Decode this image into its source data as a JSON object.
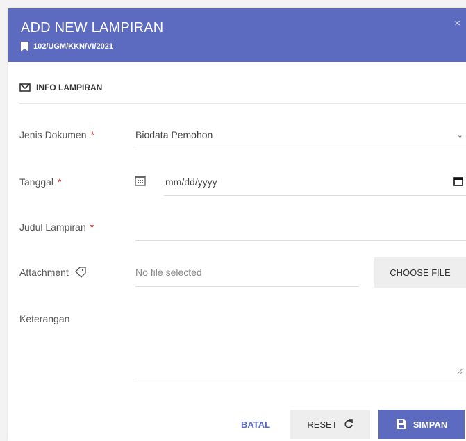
{
  "modal": {
    "title": "ADD NEW LAMPIRAN",
    "subtitle": "102/UGM/KKN/VI/2021",
    "close": "×"
  },
  "section": {
    "title": "INFO LAMPIRAN",
    "icon": "mail-icon"
  },
  "form": {
    "jenis_dokumen": {
      "label": "Jenis Dokumen",
      "required": "*",
      "value": "Biodata Pemohon",
      "chevron": "⌄"
    },
    "tanggal": {
      "label": "Tanggal",
      "required": "*",
      "placeholder": "mm/dd/yyyy"
    },
    "judul": {
      "label": "Judul Lampiran",
      "required": "*",
      "value": ""
    },
    "attachment": {
      "label": "Attachment",
      "status": "No file selected",
      "button": "CHOOSE FILE"
    },
    "keterangan": {
      "label": "Keterangan",
      "value": ""
    }
  },
  "footer": {
    "batal": "BATAL",
    "reset": "RESET",
    "simpan": "SIMPAN"
  },
  "colors": {
    "accent": "#5c6bc0",
    "required": "#e53935"
  }
}
